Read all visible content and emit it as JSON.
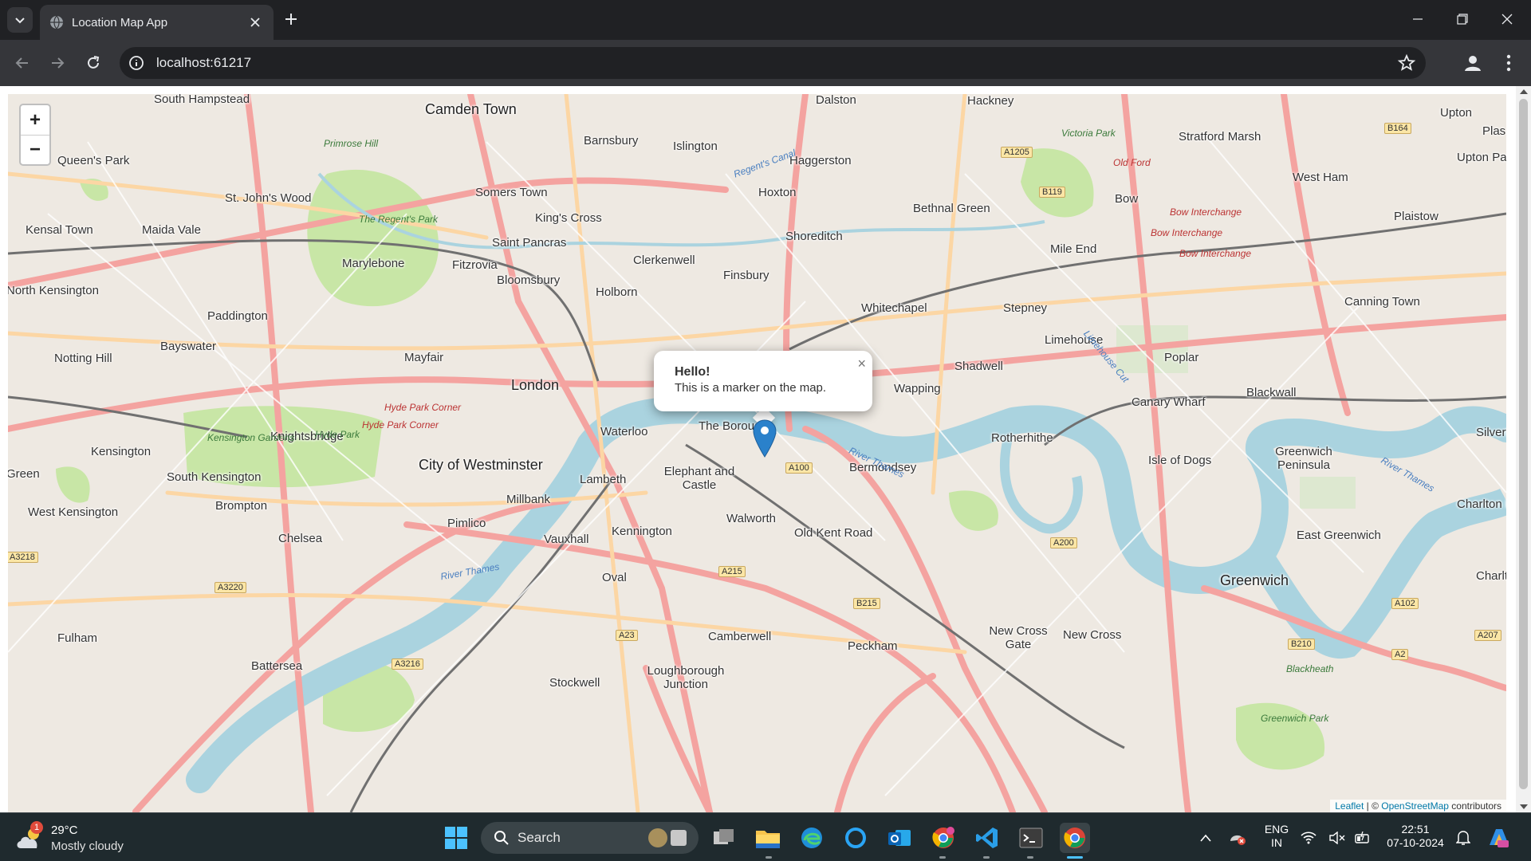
{
  "browser": {
    "tab_title": "Location Map App",
    "url": "localhost:61217"
  },
  "map": {
    "zoom_in_label": "+",
    "zoom_out_label": "−",
    "popup": {
      "title": "Hello!",
      "text": "This is a marker on the map.",
      "close_label": "×"
    },
    "attribution": {
      "leaflet": "Leaflet",
      "separator": " | © ",
      "osm": "OpenStreetMap",
      "suffix": " contributors"
    },
    "places": [
      "South Hampstead",
      "Camden Town",
      "Dalston",
      "Hackney",
      "Upton",
      "Plas",
      "Barnsbury",
      "Islington",
      "Victoria Park",
      "Stratford Marsh",
      "Primrose Hill",
      "Queen's Park",
      "Haggerston",
      "Old Ford",
      "Upton Par",
      "Hoxton",
      "West Ham",
      "St. John's Wood",
      "Somers Town",
      "Bethnal Green",
      "Bow",
      "King's Cross",
      "Kensal Town",
      "Maida Vale",
      "Saint Pancras",
      "Shoreditch",
      "Plaistow",
      "Mile End",
      "Clerkenwell",
      "Marylebone",
      "Fitzrovia",
      "Finsbury",
      "Bloomsbury",
      "North Kensington",
      "Holborn",
      "Canning Town",
      "Whitechapel",
      "Stepney",
      "Paddington",
      "Limehouse",
      "Bayswater",
      "Notting Hill",
      "Mayfair",
      "Poplar",
      "Shadwell",
      "London",
      "Wapping",
      "Blackwall",
      "Canary Wharf",
      "Silvert",
      "The Borough",
      "Waterloo",
      "Knightsbridge",
      "Rotherhithe",
      "Kensington",
      "Greenwich Peninsula",
      "Isle of Dogs",
      "City of Westminster",
      "Green",
      "Bermondsey",
      "Elephant and Castle",
      "South Kensington",
      "Lambeth",
      "Millbank",
      "Charlton R",
      "Brompton",
      "West Kensington",
      "Walworth",
      "Pimlico",
      "East Greenwich",
      "Chelsea",
      "Kennington",
      "Old Kent Road",
      "Vauxhall",
      "Oval",
      "Greenwich",
      "Charlto",
      "Fulham",
      "New Cross Gate",
      "New Cross",
      "Camberwell",
      "Peckham",
      "Battersea",
      "Loughborough Junction",
      "Stockwell",
      "Blackheath"
    ],
    "road_labels": [
      "A1205",
      "B164",
      "B119",
      "A100",
      "A200",
      "A215",
      "B215",
      "A23",
      "A3220",
      "A3216",
      "A3218",
      "A102",
      "A2",
      "B210",
      "A207"
    ],
    "red_labels": [
      "Bow Interchange",
      "Bow Interchange",
      "Bow Interchange",
      "Hyde Park Corner",
      "Hyde Park Corner",
      "Old Ford"
    ],
    "water_labels": [
      "Regent's Canal",
      "River Thames",
      "River Thames",
      "River Thames",
      "Limehouse Cut"
    ],
    "park_labels": [
      "The Regent's Park",
      "Kensington Gardens",
      "Hyde Park",
      "Greenwich Park",
      "Victoria Park"
    ]
  },
  "taskbar": {
    "weather": {
      "temp": "29°C",
      "desc": "Mostly cloudy",
      "badge": "1"
    },
    "search_label": "Search",
    "language": "ENG",
    "region": "IN",
    "time": "22:51",
    "date": "07-10-2024"
  },
  "colors": {
    "chrome_bg": "#202124",
    "toolbar_bg": "#35363a",
    "taskbar_bg": "#1f2a2e",
    "marker": "#2a81cb",
    "water": "#aad3df",
    "park": "#c8e6a6",
    "major_road": "#f4a3a0",
    "motorway": "#e892a2"
  }
}
